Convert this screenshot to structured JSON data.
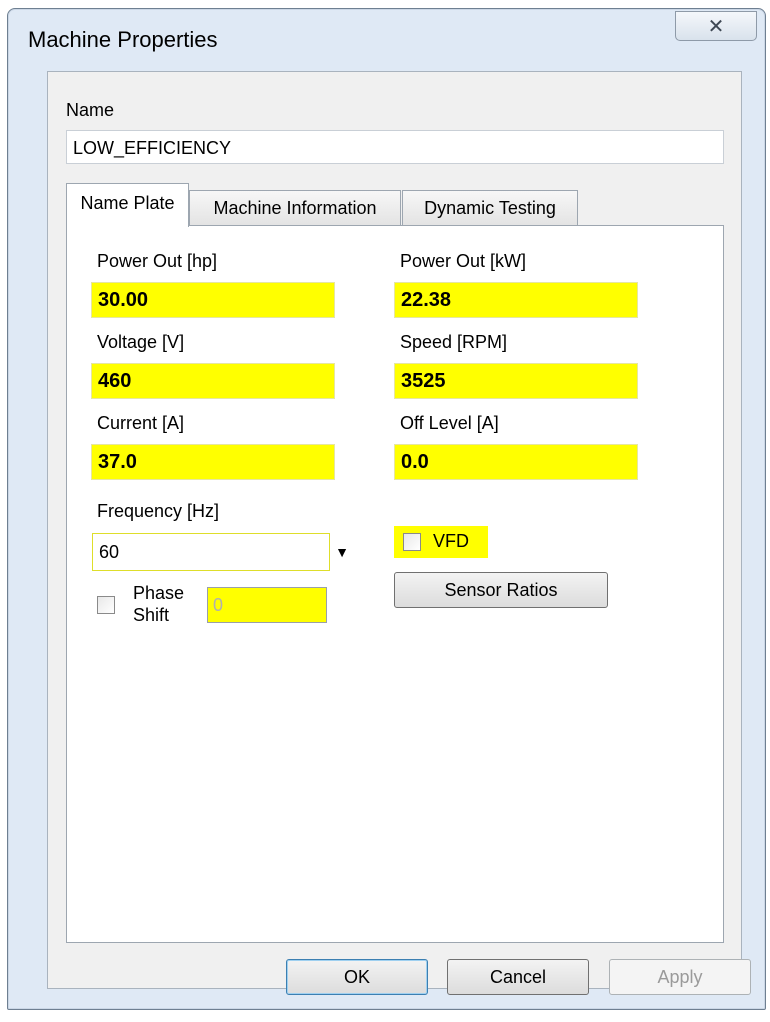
{
  "window": {
    "title": "Machine Properties",
    "close_glyph": "✕"
  },
  "name": {
    "label": "Name",
    "value": "LOW_EFFICIENCY"
  },
  "tabs": [
    {
      "label": "Name Plate",
      "active": true
    },
    {
      "label": "Machine Information",
      "active": false
    },
    {
      "label": "Dynamic Testing",
      "active": false
    }
  ],
  "fields": {
    "power_out_hp": {
      "label": "Power Out [hp]",
      "value": "30.00"
    },
    "power_out_kw": {
      "label": "Power Out [kW]",
      "value": "22.38"
    },
    "voltage": {
      "label": "Voltage [V]",
      "value": "460"
    },
    "speed": {
      "label": "Speed [RPM]",
      "value": "3525"
    },
    "current": {
      "label": "Current [A]",
      "value": "37.0"
    },
    "off_level": {
      "label": "Off Level [A]",
      "value": "0.0"
    },
    "frequency": {
      "label": "Frequency [Hz]",
      "value": "60"
    },
    "vfd": {
      "label": "VFD",
      "checked": false
    },
    "phase_shift": {
      "label_line1": "Phase",
      "label_line2": "Shift",
      "value": "0",
      "checked": false
    }
  },
  "sensor_button": "Sensor Ratios",
  "buttons": {
    "ok": "OK",
    "cancel": "Cancel",
    "apply": "Apply"
  },
  "colors": {
    "highlight": "#ffff00",
    "window_frame": "#dfe9f5"
  }
}
